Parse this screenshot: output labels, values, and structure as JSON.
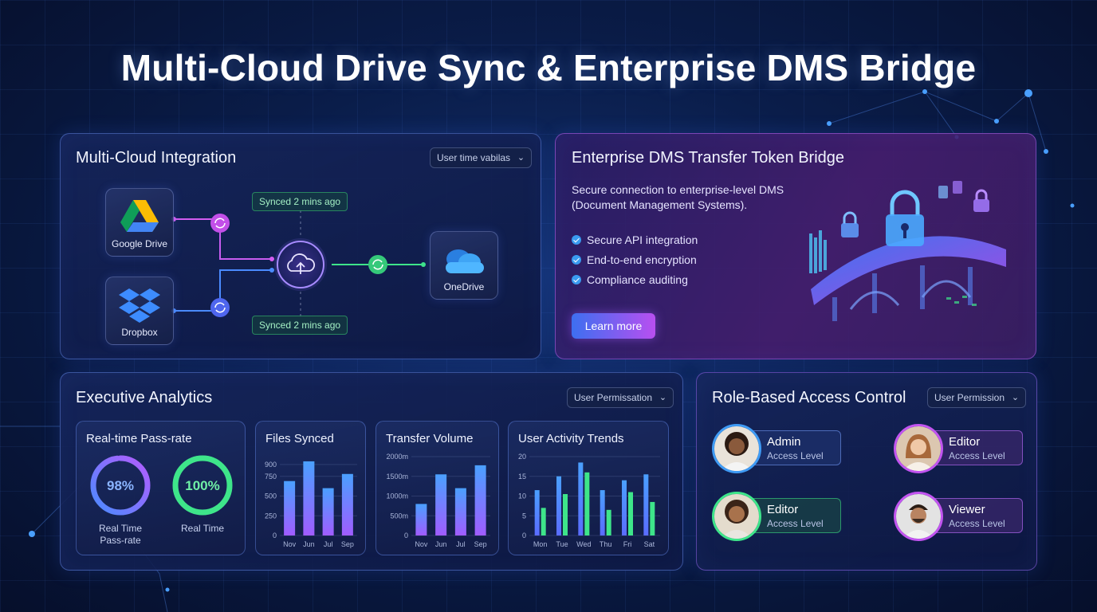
{
  "page": {
    "title": "Multi-Cloud Drive Sync & Enterprise DMS Bridge"
  },
  "colors": {
    "background": "#0a1d4a",
    "panel_border": "#6e96ff",
    "accent_blue": "#3f9bf5",
    "accent_purple": "#b84ff0",
    "accent_green": "#3ee58a"
  },
  "multi_cloud": {
    "title": "Multi-Cloud Integration",
    "dropdown": "User time vabilas",
    "services": [
      {
        "label": "Google Drive",
        "icon": "google-drive-icon"
      },
      {
        "label": "Dropbox",
        "icon": "dropbox-icon"
      },
      {
        "label": "OneDrive",
        "icon": "onedrive-icon"
      }
    ],
    "hub_icon": "cloud-upload-icon",
    "sync_icon": "sync-icon",
    "sync_badges": [
      "Synced 2 mins ago",
      "Synced 2 mins ago"
    ]
  },
  "dms": {
    "title": "Enterprise DMS Transfer Token Bridge",
    "description": "Secure connection to enterprise-level DMS (Document Management Systems).",
    "features": [
      "Secure API integration",
      "End-to-end encryption",
      "Compliance auditing"
    ],
    "button": "Learn more",
    "illustration": "secure-bridge-lock-illustration"
  },
  "analytics": {
    "title": "Executive Analytics",
    "dropdown": "User Permissation",
    "passrate": {
      "title": "Real-time Pass-rate",
      "rings": [
        {
          "value": "98%",
          "fraction": 0.98,
          "label": "Real Time Pass-rate",
          "color": "#8a6cff"
        },
        {
          "value": "100%",
          "fraction": 1.0,
          "label": "Real Time",
          "color": "#3ee58a"
        }
      ]
    }
  },
  "chart_data": [
    {
      "type": "bar",
      "title": "Files Synced",
      "categories": [
        "Nov",
        "Jun",
        "Jul",
        "Sep"
      ],
      "values": [
        690,
        940,
        600,
        780
      ],
      "yticks": [
        "900",
        "750",
        "500",
        "250",
        "0"
      ],
      "ytick_values": [
        900,
        750,
        500,
        250,
        0
      ],
      "ylim": [
        0,
        1000
      ]
    },
    {
      "type": "bar",
      "title": "Transfer Volume",
      "categories": [
        "Nov",
        "Jun",
        "Jul",
        "Sep"
      ],
      "values": [
        800,
        1550,
        1200,
        1780
      ],
      "yticks": [
        "2000m",
        "1500m",
        "1000m",
        "500m",
        "0"
      ],
      "ytick_values": [
        2000,
        1500,
        1000,
        500,
        0
      ],
      "ylim": [
        0,
        2000
      ]
    },
    {
      "type": "bar",
      "title": "User Activity Trends",
      "categories": [
        "Mon",
        "Tue",
        "Wed",
        "Thu",
        "Fri",
        "Sat"
      ],
      "series": [
        {
          "values": [
            11.5,
            15,
            18.5,
            11.5,
            14,
            15.5
          ]
        },
        {
          "values": [
            7,
            10.5,
            16,
            6.5,
            11,
            8.5
          ]
        }
      ],
      "yticks": [
        "20",
        "15",
        "10",
        "5",
        "0"
      ],
      "ytick_values": [
        20,
        15,
        10,
        5,
        0
      ],
      "ylim": [
        0,
        20
      ]
    }
  ],
  "rbac": {
    "title": "Role-Based Access Control",
    "dropdown": "User Permission",
    "roles": [
      {
        "name": "Admin",
        "level": "Access Level",
        "ring": "#3f9bf5"
      },
      {
        "name": "Editor",
        "level": "Access Level",
        "ring": "#c254f0"
      },
      {
        "name": "Editor",
        "level": "Access Level",
        "ring": "#3ee58a"
      },
      {
        "name": "Viewer",
        "level": "Access Level",
        "ring": "#c254f0"
      }
    ]
  }
}
